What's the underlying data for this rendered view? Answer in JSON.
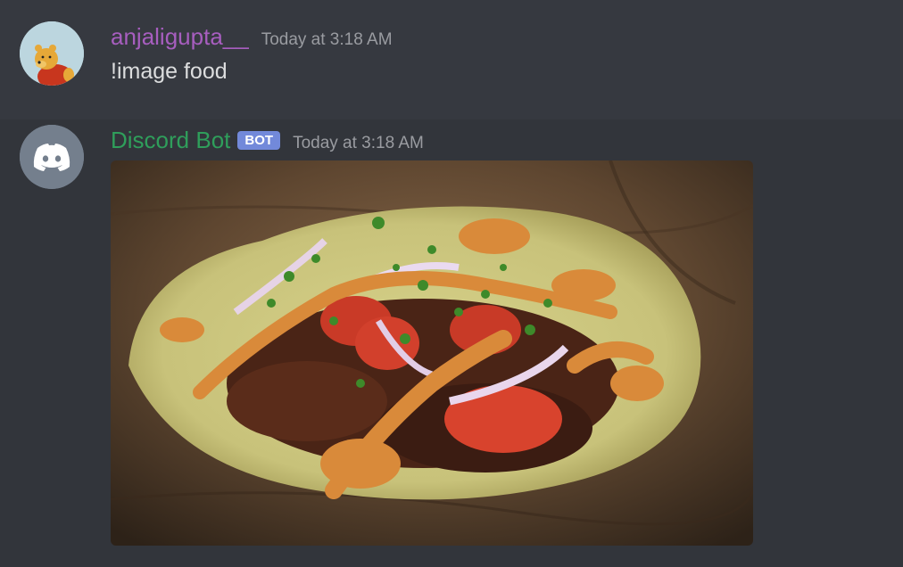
{
  "messages": [
    {
      "username": "anjaligupta__",
      "timestamp": "Today at 3:18 AM",
      "content": "!image food",
      "avatar": "winnie-the-pooh-avatar",
      "username_color": "#a75ebf"
    },
    {
      "username": "Discord Bot",
      "badge": "BOT",
      "timestamp": "Today at 3:18 AM",
      "avatar": "discord-logo-avatar",
      "username_color": "#2f9e5b",
      "attachment": "taco-photo"
    }
  ],
  "colors": {
    "background": "#36393f",
    "bot_badge": "#7289da"
  }
}
